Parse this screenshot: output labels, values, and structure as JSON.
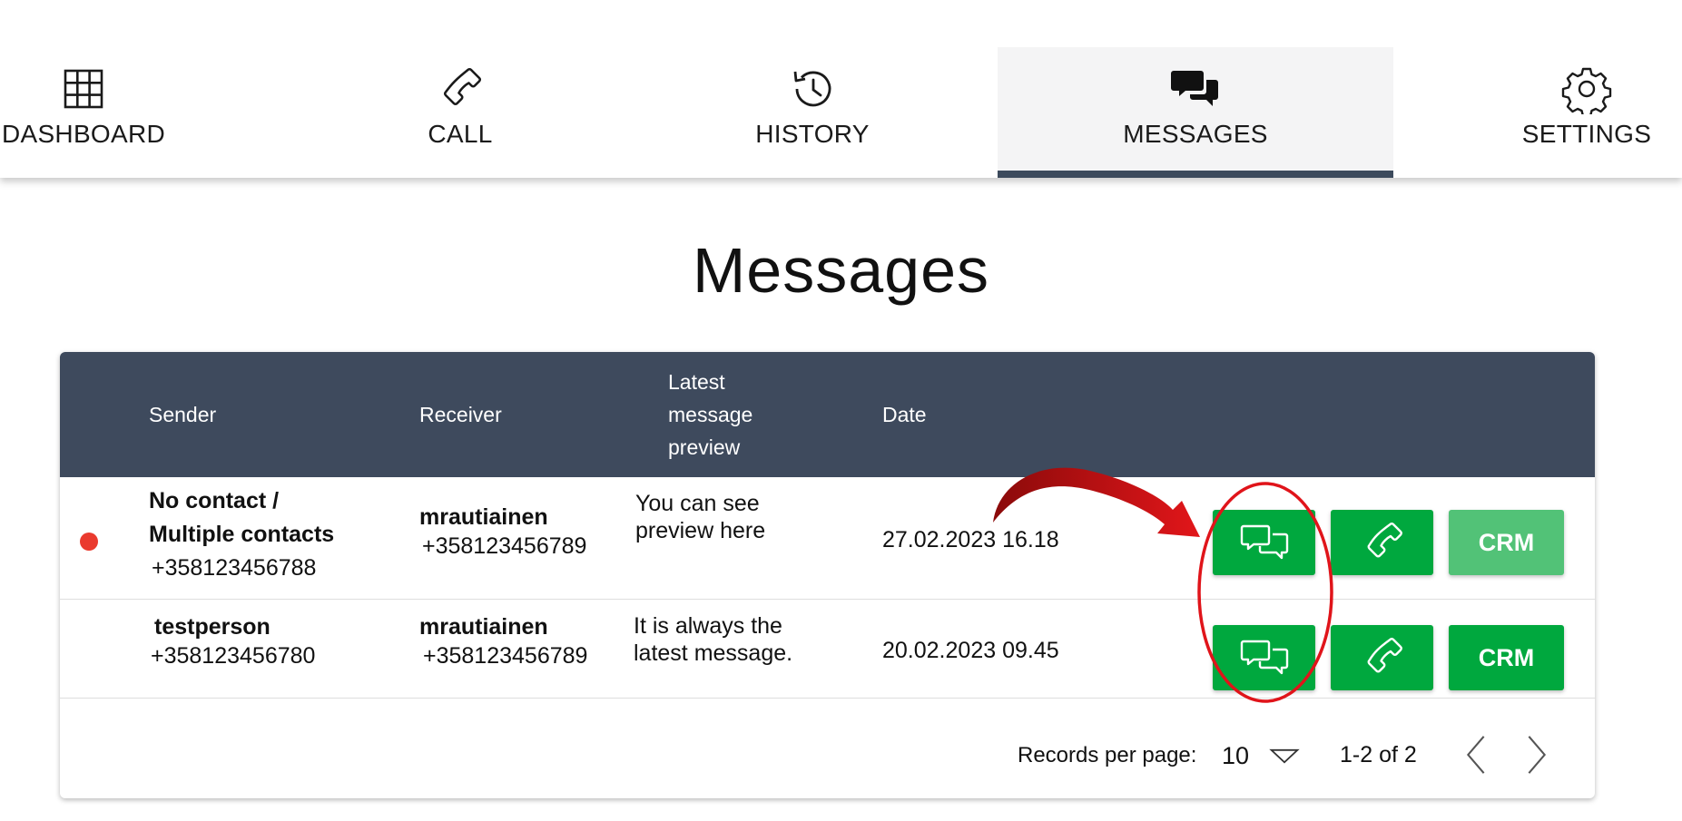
{
  "nav": {
    "items": [
      {
        "label": "DASHBOARD",
        "icon": "grid-icon"
      },
      {
        "label": "CALL",
        "icon": "phone-icon"
      },
      {
        "label": "HISTORY",
        "icon": "history-icon"
      },
      {
        "label": "MESSAGES",
        "icon": "chat-bubbles-icon",
        "active": true
      },
      {
        "label": "SETTINGS",
        "icon": "gear-icon"
      }
    ]
  },
  "page": {
    "title": "Messages"
  },
  "table": {
    "headers": {
      "sender": "Sender",
      "receiver": "Receiver",
      "preview": [
        "Latest",
        "message",
        "preview"
      ],
      "date": "Date"
    },
    "rows": [
      {
        "unread": true,
        "sender_name": [
          "No contact /",
          "Multiple contacts"
        ],
        "sender_phone": "+358123456788",
        "receiver_name": "mrautiainen",
        "receiver_phone": "+358123456789",
        "preview": [
          "You can see",
          "preview here"
        ],
        "date": "27.02.2023 16.18",
        "crm_label": "CRM",
        "crm_enabled": false
      },
      {
        "unread": false,
        "sender_name": [
          "testperson"
        ],
        "sender_phone": "+358123456780",
        "receiver_name": "mrautiainen",
        "receiver_phone": "+358123456789",
        "preview": [
          "It is always the",
          "latest message."
        ],
        "date": "20.02.2023 09.45",
        "crm_label": "CRM",
        "crm_enabled": true
      }
    ]
  },
  "pagination": {
    "records_label": "Records per page:",
    "per_page": "10",
    "range": "1-2 of 2"
  },
  "colors": {
    "header_bg": "#3e4a5d",
    "accent_green": "#00a83e",
    "unread_dot": "#ea3a2e",
    "annotation_red": "#e0141a"
  }
}
